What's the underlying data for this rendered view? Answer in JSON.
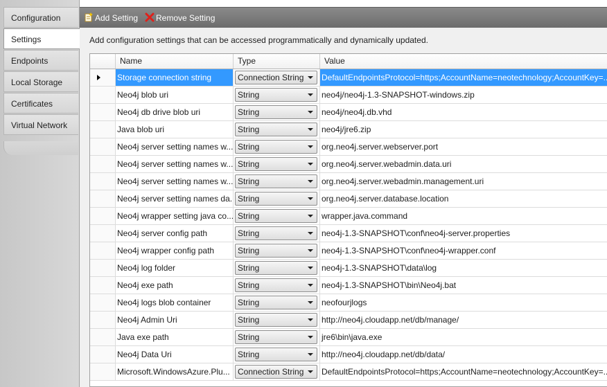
{
  "tabs": [
    {
      "label": "Configuration",
      "selected": false
    },
    {
      "label": "Settings",
      "selected": true
    },
    {
      "label": "Endpoints",
      "selected": false
    },
    {
      "label": "Local Storage",
      "selected": false
    },
    {
      "label": "Certificates",
      "selected": false
    },
    {
      "label": "Virtual Network",
      "selected": false
    }
  ],
  "toolbar": {
    "add_label": "Add Setting",
    "add_icon": "add-setting-icon",
    "remove_label": "Remove Setting",
    "remove_icon": "remove-icon"
  },
  "description": "Add configuration settings that can be accessed programmatically and dynamically updated.",
  "grid": {
    "columns": [
      "Name",
      "Type",
      "Value"
    ],
    "selected_row": 0,
    "rows": [
      {
        "name": "Storage connection string",
        "type": "Connection String",
        "value": "DefaultEndpointsProtocol=https;AccountName=neotechnology;AccountKey=..."
      },
      {
        "name": "Neo4j blob uri",
        "type": "String",
        "value": "neo4j/neo4j-1.3-SNAPSHOT-windows.zip"
      },
      {
        "name": "Neo4j db drive blob uri",
        "type": "String",
        "value": "neo4j/neo4j.db.vhd"
      },
      {
        "name": "Java blob uri",
        "type": "String",
        "value": "neo4j/jre6.zip"
      },
      {
        "name": "Neo4j server setting names w...",
        "type": "String",
        "value": "org.neo4j.server.webserver.port"
      },
      {
        "name": "Neo4j server setting names w...",
        "type": "String",
        "value": "org.neo4j.server.webadmin.data.uri"
      },
      {
        "name": "Neo4j server setting names w...",
        "type": "String",
        "value": "org.neo4j.server.webadmin.management.uri"
      },
      {
        "name": "Neo4j server setting names da...",
        "type": "String",
        "value": "org.neo4j.server.database.location"
      },
      {
        "name": "Neo4j wrapper setting java co...",
        "type": "String",
        "value": "wrapper.java.command"
      },
      {
        "name": "Neo4j server config path",
        "type": "String",
        "value": "neo4j-1.3-SNAPSHOT\\conf\\neo4j-server.properties"
      },
      {
        "name": "Neo4j wrapper config path",
        "type": "String",
        "value": "neo4j-1.3-SNAPSHOT\\conf\\neo4j-wrapper.conf"
      },
      {
        "name": "Neo4j log folder",
        "type": "String",
        "value": "neo4j-1.3-SNAPSHOT\\data\\log"
      },
      {
        "name": "Neo4j exe path",
        "type": "String",
        "value": "neo4j-1.3-SNAPSHOT\\bin\\Neo4j.bat"
      },
      {
        "name": "Neo4j logs blob container",
        "type": "String",
        "value": "neofourjlogs"
      },
      {
        "name": "Neo4j Admin Uri",
        "type": "String",
        "value": "http://neo4j.cloudapp.net/db/manage/"
      },
      {
        "name": "Java exe path",
        "type": "String",
        "value": "jre6\\bin\\java.exe"
      },
      {
        "name": "Neo4j Data Uri",
        "type": "String",
        "value": "http://neo4j.cloudapp.net/db/data/"
      },
      {
        "name": "Microsoft.WindowsAzure.Plu...",
        "type": "Connection String",
        "value": "DefaultEndpointsProtocol=https;AccountName=neotechnology;AccountKey=..."
      }
    ]
  }
}
